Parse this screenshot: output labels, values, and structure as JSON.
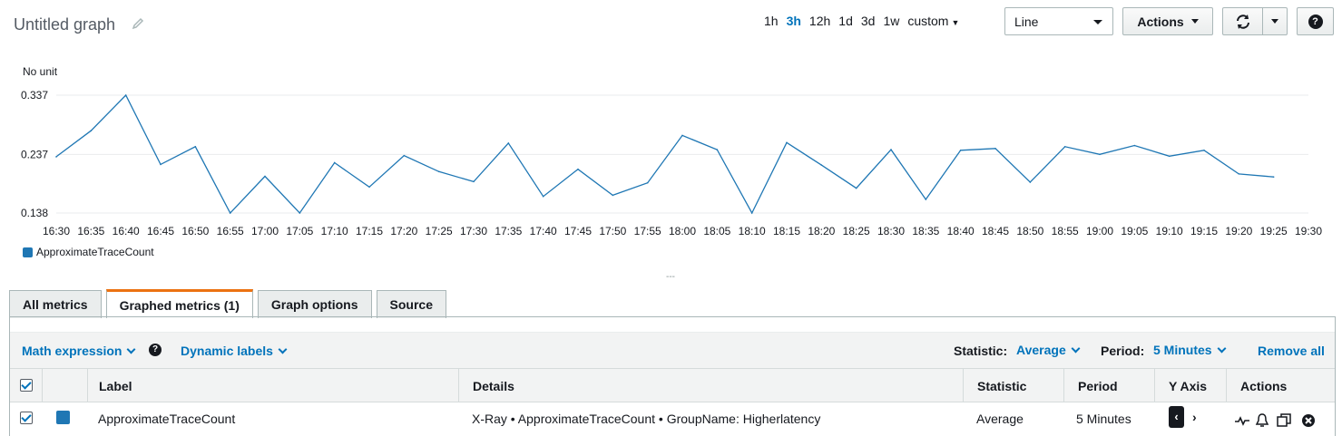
{
  "header": {
    "title": "Untitled graph",
    "time_ranges": [
      {
        "label": "1h",
        "active": false
      },
      {
        "label": "3h",
        "active": true
      },
      {
        "label": "12h",
        "active": false
      },
      {
        "label": "1d",
        "active": false
      },
      {
        "label": "3d",
        "active": false
      },
      {
        "label": "1w",
        "active": false
      }
    ],
    "custom_label": "custom",
    "chart_type": "Line",
    "actions_label": "Actions",
    "help_label": "?"
  },
  "chart_data": {
    "type": "line",
    "ylabel": "No unit",
    "ylim": [
      0.138,
      0.337
    ],
    "y_ticks": [
      "0.337",
      "0.237",
      "0.138"
    ],
    "x": [
      "16:30",
      "16:35",
      "16:40",
      "16:45",
      "16:50",
      "16:55",
      "17:00",
      "17:05",
      "17:10",
      "17:15",
      "17:20",
      "17:25",
      "17:30",
      "17:35",
      "17:40",
      "17:45",
      "17:50",
      "17:55",
      "18:00",
      "18:05",
      "18:10",
      "18:15",
      "18:20",
      "18:25",
      "18:30",
      "18:35",
      "18:40",
      "18:45",
      "18:50",
      "18:55",
      "19:00",
      "19:05",
      "19:10",
      "19:15",
      "19:20",
      "19:25",
      "19:30"
    ],
    "series": [
      {
        "name": "ApproximateTraceCount",
        "color": "#1f77b4",
        "values": [
          0.233,
          0.277,
          0.337,
          0.22,
          0.25,
          0.138,
          0.2,
          0.138,
          0.223,
          0.182,
          0.235,
          0.208,
          0.191,
          0.256,
          0.166,
          0.212,
          0.168,
          0.189,
          0.269,
          0.245,
          0.138,
          0.257,
          0.219,
          0.18,
          0.245,
          0.161,
          0.244,
          0.247,
          0.19,
          0.25,
          0.237,
          0.252,
          0.234,
          0.244,
          0.204,
          0.199
        ]
      }
    ],
    "grid": true,
    "legend_position": "bottom-left"
  },
  "graph_tabs": [
    "All metrics",
    "Graphed metrics (1)",
    "Graph options",
    "Source"
  ],
  "toolbar": {
    "math_expression": "Math expression",
    "dynamic_labels": "Dynamic labels",
    "statistic_label": "Statistic:",
    "statistic_value": "Average",
    "period_label": "Period:",
    "period_value": "5 Minutes",
    "remove_all": "Remove all"
  },
  "table": {
    "columns": [
      "Label",
      "Details",
      "Statistic",
      "Period",
      "Y Axis",
      "Actions"
    ],
    "rows": [
      {
        "label": "ApproximateTraceCount",
        "details": "X-Ray • ApproximateTraceCount • GroupName: Higherlatency",
        "statistic": "Average",
        "period": "5 Minutes",
        "color": "#1f77b4",
        "y_axis_left": "‹",
        "y_axis_right": "›"
      }
    ]
  },
  "divider": "---"
}
